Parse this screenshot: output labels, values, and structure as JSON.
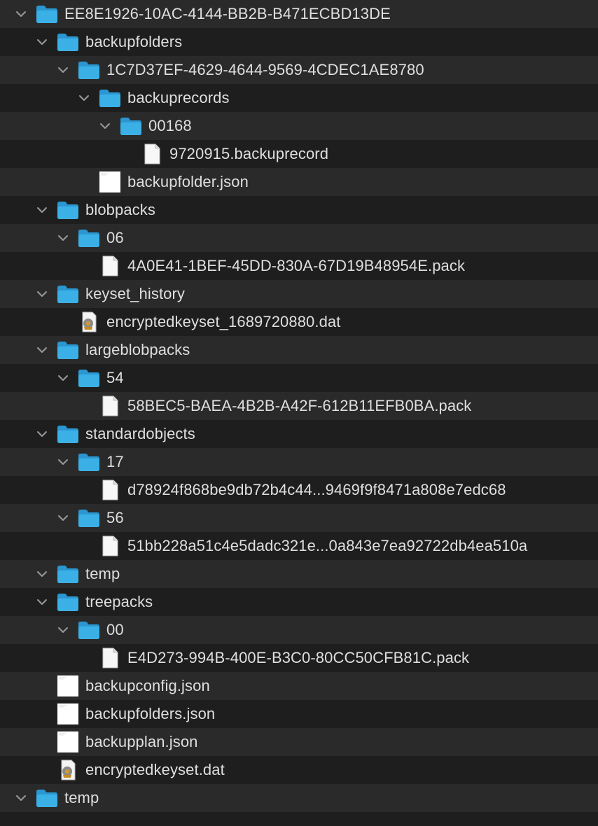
{
  "window": {
    "background": "#1e1e1e",
    "stripe": "#2a2a2a",
    "text_color": "#dfdfdf"
  },
  "colors": {
    "folder": "#3bb0e6",
    "folder_tab": "#2a97d3",
    "chevron": "#9a9a9a"
  },
  "rows": [
    {
      "label": "EE8E1926-10AC-4144-BB2B-B471ECBD13DE",
      "type": "folder",
      "expanded": true,
      "depth": 0,
      "icon": "folder-icon"
    },
    {
      "label": "backupfolders",
      "type": "folder",
      "expanded": true,
      "depth": 1,
      "icon": "folder-icon"
    },
    {
      "label": "1C7D37EF-4629-4644-9569-4CDEC1AE8780",
      "type": "folder",
      "expanded": true,
      "depth": 2,
      "icon": "folder-icon"
    },
    {
      "label": "backuprecords",
      "type": "folder",
      "expanded": true,
      "depth": 3,
      "icon": "folder-icon"
    },
    {
      "label": "00168",
      "type": "folder",
      "expanded": true,
      "depth": 4,
      "icon": "folder-icon"
    },
    {
      "label": "9720915.backuprecord",
      "type": "file",
      "depth": 5,
      "icon": "document-icon"
    },
    {
      "label": "backupfolder.json",
      "type": "json",
      "depth": 3,
      "icon": "json-file-icon"
    },
    {
      "label": "blobpacks",
      "type": "folder",
      "expanded": true,
      "depth": 1,
      "icon": "folder-icon"
    },
    {
      "label": "06",
      "type": "folder",
      "expanded": true,
      "depth": 2,
      "icon": "folder-icon"
    },
    {
      "label": "4A0E41-1BEF-45DD-830A-67D19B48954E.pack",
      "type": "file",
      "depth": 3,
      "icon": "document-icon"
    },
    {
      "label": "keyset_history",
      "type": "folder",
      "expanded": true,
      "depth": 1,
      "icon": "folder-icon"
    },
    {
      "label": "encryptedkeyset_1689720880.dat",
      "type": "dat",
      "depth": 2,
      "icon": "dat-file-icon"
    },
    {
      "label": "largeblobpacks",
      "type": "folder",
      "expanded": true,
      "depth": 1,
      "icon": "folder-icon"
    },
    {
      "label": "54",
      "type": "folder",
      "expanded": true,
      "depth": 2,
      "icon": "folder-icon"
    },
    {
      "label": "58BEC5-BAEA-4B2B-A42F-612B11EFB0BA.pack",
      "type": "file",
      "depth": 3,
      "icon": "document-icon"
    },
    {
      "label": "standardobjects",
      "type": "folder",
      "expanded": true,
      "depth": 1,
      "icon": "folder-icon"
    },
    {
      "label": "17",
      "type": "folder",
      "expanded": true,
      "depth": 2,
      "icon": "folder-icon"
    },
    {
      "label": "d78924f868be9db72b4c44...9469f9f8471a808e7edc68",
      "type": "file",
      "depth": 3,
      "icon": "document-icon"
    },
    {
      "label": "56",
      "type": "folder",
      "expanded": true,
      "depth": 2,
      "icon": "folder-icon"
    },
    {
      "label": "51bb228a51c4e5dadc321e...0a843e7ea92722db4ea510a",
      "type": "file",
      "depth": 3,
      "icon": "document-icon"
    },
    {
      "label": "temp",
      "type": "folder",
      "expanded": true,
      "depth": 1,
      "icon": "folder-icon"
    },
    {
      "label": "treepacks",
      "type": "folder",
      "expanded": true,
      "depth": 1,
      "icon": "folder-icon"
    },
    {
      "label": "00",
      "type": "folder",
      "expanded": true,
      "depth": 2,
      "icon": "folder-icon"
    },
    {
      "label": "E4D273-994B-400E-B3C0-80CC50CFB81C.pack",
      "type": "file",
      "depth": 3,
      "icon": "document-icon"
    },
    {
      "label": "backupconfig.json",
      "type": "json",
      "depth": 1,
      "icon": "json-file-icon"
    },
    {
      "label": "backupfolders.json",
      "type": "json",
      "depth": 1,
      "icon": "json-file-icon"
    },
    {
      "label": "backupplan.json",
      "type": "json",
      "depth": 1,
      "icon": "json-file-icon"
    },
    {
      "label": "encryptedkeyset.dat",
      "type": "dat",
      "depth": 1,
      "icon": "dat-file-icon"
    },
    {
      "label": "temp",
      "type": "folder",
      "expanded": true,
      "depth": 0,
      "icon": "folder-icon"
    }
  ]
}
